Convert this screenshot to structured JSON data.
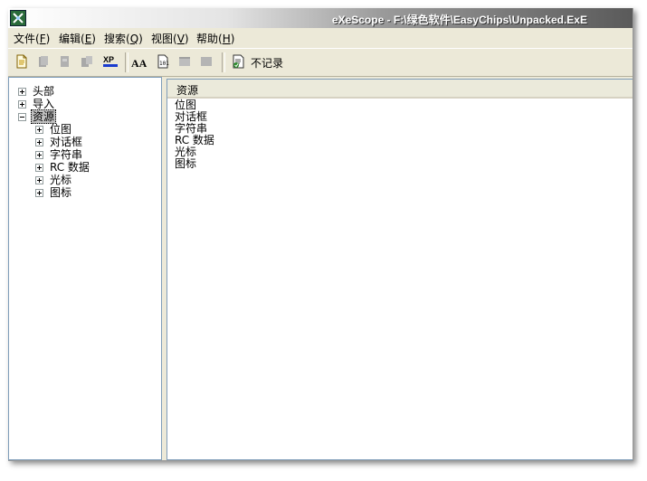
{
  "window": {
    "title": "eXeScope - F:\\绿色软件\\EasyChips\\Unpacked.ExE"
  },
  "menu": [
    {
      "label": "文件(",
      "key": "F",
      "suffix": ")"
    },
    {
      "label": "编辑(",
      "key": "E",
      "suffix": ")"
    },
    {
      "label": "搜索(",
      "key": "Q",
      "suffix": ")"
    },
    {
      "label": "视图(",
      "key": "V",
      "suffix": ")"
    },
    {
      "label": "帮助(",
      "key": "H",
      "suffix": ")"
    }
  ],
  "toolbar": {
    "xp_label": "XP",
    "font_label": "AA",
    "no_record_label": "不记录"
  },
  "tree": {
    "nodes": [
      {
        "label": "头部",
        "expander": "plus"
      },
      {
        "label": "导入",
        "expander": "plus"
      },
      {
        "label": "资源",
        "expander": "minus",
        "selected": true
      },
      {
        "label": "位图",
        "expander": "plus"
      },
      {
        "label": "对话框",
        "expander": "plus"
      },
      {
        "label": "字符串",
        "expander": "plus"
      },
      {
        "label": "RC 数据",
        "expander": "plus"
      },
      {
        "label": "光标",
        "expander": "plus"
      },
      {
        "label": "图标",
        "expander": "plus"
      }
    ]
  },
  "list": {
    "column_header": "资源",
    "items": [
      "位图",
      "对话框",
      "字符串",
      "RC 数据",
      "光标",
      "图标"
    ]
  }
}
